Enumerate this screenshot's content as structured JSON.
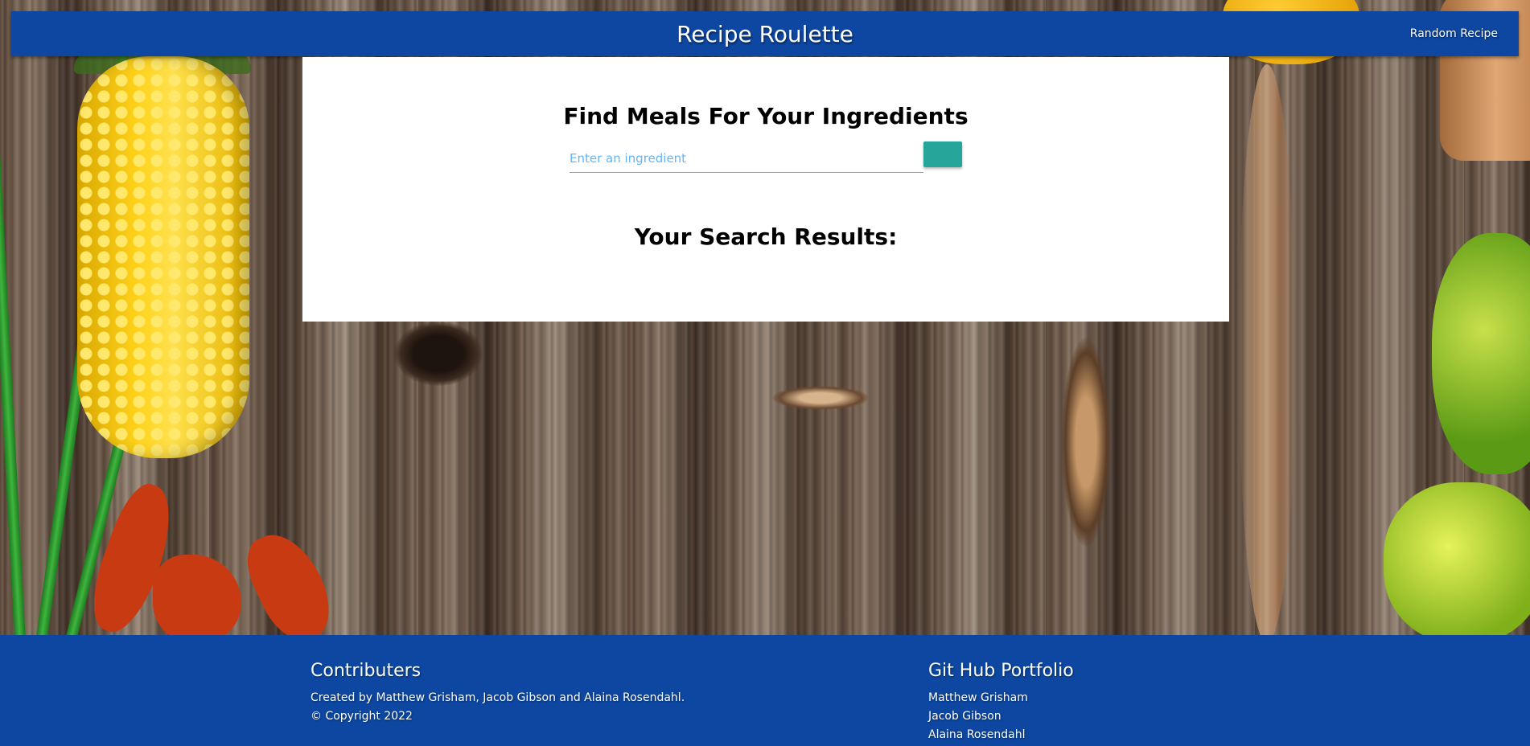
{
  "header": {
    "title": "Recipe Roulette",
    "nav_link": "Random Recipe"
  },
  "main": {
    "heading": "Find Meals For Your Ingredients",
    "search": {
      "placeholder": "Enter an ingredient",
      "value": ""
    },
    "results_heading": "Your Search Results:"
  },
  "footer": {
    "contributors": {
      "heading": "Contributers",
      "credit": "Created by Matthew Grisham, Jacob Gibson and Alaina Rosendahl.",
      "copyright": "© Copyright 2022"
    },
    "github": {
      "heading": "Git Hub Portfolio",
      "links": [
        "Matthew Grisham",
        "Jacob Gibson",
        "Alaina Rosendahl"
      ]
    }
  },
  "colors": {
    "header_bg": "#0d47a1",
    "footer_bg": "#0d47a1",
    "button_bg": "#26a69a",
    "placeholder": "#64b5f6"
  },
  "icons": {
    "background": "wooden-table-with-vegetables-image"
  }
}
